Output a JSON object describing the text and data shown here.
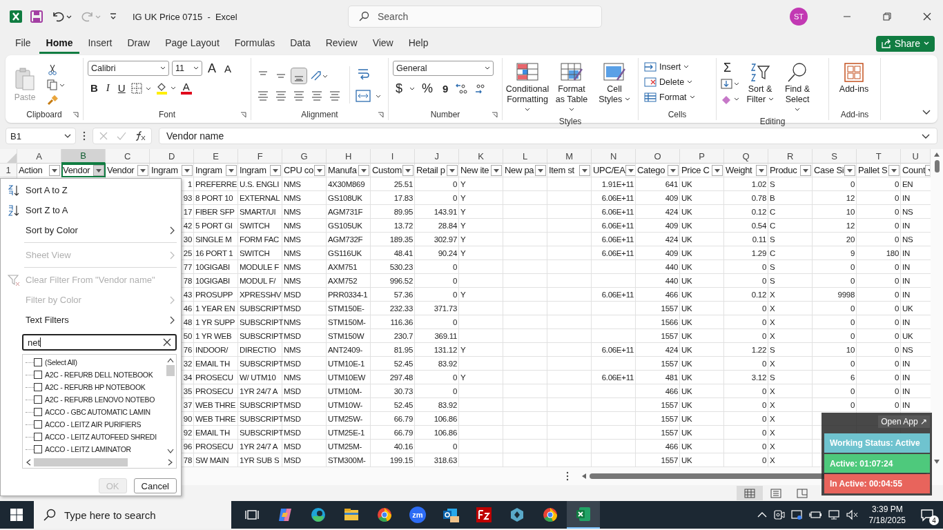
{
  "titlebar": {
    "title": "IG UK Price 0715  -  Excel",
    "search_placeholder": "Search",
    "avatar": "ST"
  },
  "menu_tabs": [
    {
      "label": "File",
      "selected": false
    },
    {
      "label": "Home",
      "selected": true
    },
    {
      "label": "Insert",
      "selected": false
    },
    {
      "label": "Draw",
      "selected": false
    },
    {
      "label": "Page Layout",
      "selected": false
    },
    {
      "label": "Formulas",
      "selected": false
    },
    {
      "label": "Data",
      "selected": false
    },
    {
      "label": "Review",
      "selected": false
    },
    {
      "label": "View",
      "selected": false
    },
    {
      "label": "Help",
      "selected": false
    }
  ],
  "share": "Share",
  "ribbon": {
    "clipboard": {
      "paste": "Paste",
      "label": "Clipboard"
    },
    "font": {
      "name": "Calibri",
      "size": "11",
      "grow": "A",
      "shrink": "A",
      "bold": "B",
      "italic": "I",
      "underline": "U",
      "color_glyph": "A",
      "label": "Font"
    },
    "alignment": {
      "label": "Alignment",
      "vertical": [
        {
          "kind": "top",
          "on": false
        },
        {
          "kind": "middle",
          "on": false
        },
        {
          "kind": "bottom",
          "on": true
        }
      ]
    },
    "number": {
      "format": "General",
      "currency": "$",
      "percent": "%",
      "comma": "9",
      "label": "Number"
    },
    "styles": {
      "buttons": [
        {
          "label": "Conditional Formatting",
          "kind": "conditional"
        },
        {
          "label": "Format as Table",
          "kind": "table"
        },
        {
          "label": "Cell Styles",
          "kind": "cell-styles"
        }
      ],
      "label": "Styles"
    },
    "cells": {
      "buttons": [
        {
          "label": "Insert",
          "kind": "insert"
        },
        {
          "label": "Delete",
          "kind": "delete"
        },
        {
          "label": "Format",
          "kind": "format"
        }
      ],
      "label": "Cells"
    },
    "editing": {
      "sum": "Σ",
      "buttons": [
        {
          "label": "Sort & Filter",
          "kind": "sort"
        },
        {
          "label": "Find & Select",
          "kind": "find"
        }
      ],
      "label": "Editing"
    },
    "addins": {
      "button": "Add-ins",
      "label": "Add-ins"
    }
  },
  "formula_bar": {
    "name_box": "B1",
    "formula": "Vendor name"
  },
  "row_number": "1",
  "columns": [
    {
      "letter": "A",
      "heading": "Action",
      "selected": false
    },
    {
      "letter": "B",
      "heading": "Vendor",
      "selected": true
    },
    {
      "letter": "C",
      "heading": "Vendor",
      "selected": false
    },
    {
      "letter": "D",
      "heading": "Ingram",
      "kind": "number",
      "selected": false
    },
    {
      "letter": "E",
      "heading": "Ingram",
      "kind": "text",
      "selected": false
    },
    {
      "letter": "F",
      "heading": "Ingram",
      "kind": "text",
      "selected": false
    },
    {
      "letter": "G",
      "heading": "CPU co",
      "kind": "text",
      "selected": false
    },
    {
      "letter": "H",
      "heading": "Manufa",
      "kind": "text",
      "selected": false
    },
    {
      "letter": "I",
      "heading": "Custom",
      "kind": "number",
      "selected": false
    },
    {
      "letter": "J",
      "heading": "Retail p",
      "kind": "number",
      "selected": false
    },
    {
      "letter": "K",
      "heading": "New ite",
      "kind": "text",
      "selected": false
    },
    {
      "letter": "L",
      "heading": "New pa",
      "selected": false
    },
    {
      "letter": "M",
      "heading": "Item st",
      "selected": false
    },
    {
      "letter": "N",
      "heading": "UPC/EA",
      "kind": "number",
      "selected": false
    },
    {
      "letter": "O",
      "heading": "Catego",
      "kind": "number",
      "selected": false
    },
    {
      "letter": "P",
      "heading": "Price C",
      "kind": "text",
      "selected": false
    },
    {
      "letter": "Q",
      "heading": "Weight",
      "kind": "number",
      "selected": false
    },
    {
      "letter": "R",
      "heading": "Produc",
      "kind": "text",
      "selected": false
    },
    {
      "letter": "S",
      "heading": "Case Si",
      "kind": "number",
      "selected": false
    },
    {
      "letter": "T",
      "heading": "Pallet S",
      "kind": "number",
      "selected": false
    },
    {
      "letter": "U",
      "heading": "Count",
      "kind": "text",
      "selected": false
    }
  ],
  "rows": [
    {
      "D": "1",
      "E": "PREFERRE",
      "F": "U.S. ENGLI",
      "G": "NMS",
      "H": "4X30M869",
      "I": "25.51",
      "J": "0",
      "K": "Y",
      "N": "1.91E+11",
      "O": "641",
      "P": "UK",
      "Q": "1.02",
      "R": "S",
      "S": "0",
      "T": "0",
      "U": "EN"
    },
    {
      "D": "93",
      "E": "8 PORT 10",
      "F": "EXTERNAL",
      "G": "NMS",
      "H": "GS108UK",
      "I": "17.83",
      "J": "0",
      "K": "Y",
      "N": "6.06E+11",
      "O": "409",
      "P": "UK",
      "Q": "0.78",
      "R": "B",
      "S": "12",
      "T": "0",
      "U": "IN"
    },
    {
      "D": "17",
      "E": "FIBER SFP",
      "F": "SMART/UI",
      "G": "NMS",
      "H": "AGM731F",
      "I": "89.95",
      "J": "143.91",
      "K": "Y",
      "N": "6.06E+11",
      "O": "424",
      "P": "UK",
      "Q": "0.12",
      "R": "C",
      "S": "10",
      "T": "0",
      "U": "NS"
    },
    {
      "D": "42",
      "E": "5 PORT GI",
      "F": "SWITCH",
      "G": "NMS",
      "H": "GS105UK",
      "I": "13.72",
      "J": "28.84",
      "K": "Y",
      "N": "6.06E+11",
      "O": "409",
      "P": "UK",
      "Q": "0.54",
      "R": "C",
      "S": "12",
      "T": "0",
      "U": "IN"
    },
    {
      "D": "30",
      "E": "SINGLE M",
      "F": "FORM FAC",
      "G": "NMS",
      "H": "AGM732F",
      "I": "189.35",
      "J": "302.97",
      "K": "Y",
      "N": "6.06E+11",
      "O": "424",
      "P": "UK",
      "Q": "0.11",
      "R": "S",
      "S": "20",
      "T": "0",
      "U": "NS"
    },
    {
      "D": "25",
      "E": "16 PORT 1",
      "F": "SWITCH",
      "G": "NMS",
      "H": "GS116UK",
      "I": "48.41",
      "J": "90.24",
      "K": "Y",
      "N": "6.06E+11",
      "O": "409",
      "P": "UK",
      "Q": "1.29",
      "R": "C",
      "S": "9",
      "T": "180",
      "U": "IN"
    },
    {
      "D": "77",
      "E": "10GIGABI",
      "F": "MODULE F",
      "G": "NMS",
      "H": "AXM751",
      "I": "530.23",
      "J": "0",
      "O": "440",
      "P": "UK",
      "Q": "0",
      "R": "S",
      "S": "0",
      "T": "0",
      "U": "IN"
    },
    {
      "D": "78",
      "E": "10GIGABI",
      "F": "MODUL F/",
      "G": "NMS",
      "H": "AXM752",
      "I": "996.52",
      "J": "0",
      "O": "440",
      "P": "UK",
      "Q": "0",
      "R": "S",
      "S": "0",
      "T": "0",
      "U": "IN"
    },
    {
      "D": "43",
      "E": "PROSUPP",
      "F": "XPRESSHV",
      "G": "MSD",
      "H": "PRR0334-1",
      "I": "57.36",
      "J": "0",
      "K": "Y",
      "N": "6.06E+11",
      "O": "466",
      "P": "UK",
      "Q": "0.12",
      "R": "X",
      "S": "9998",
      "T": "0",
      "U": "IN"
    },
    {
      "D": "46",
      "E": "1 YEAR EN",
      "F": "SUBSCRIPT",
      "G": "MSD",
      "H": "STM150E-",
      "I": "232.33",
      "J": "371.73",
      "O": "1557",
      "P": "UK",
      "Q": "0",
      "R": "X",
      "S": "0",
      "T": "0",
      "U": "UK"
    },
    {
      "D": "48",
      "E": "1 YR SUPP",
      "F": "SUBSCRIPT",
      "G": "NMS",
      "H": "STM150M-",
      "I": "116.36",
      "J": "0",
      "O": "1566",
      "P": "UK",
      "Q": "0",
      "R": "X",
      "S": "0",
      "T": "0",
      "U": "IN"
    },
    {
      "D": "50",
      "E": "1 YR WEB",
      "F": "SUBSCRIPT",
      "G": "MSD",
      "H": "STM150W",
      "I": "230.7",
      "J": "369.11",
      "O": "1557",
      "P": "UK",
      "Q": "0",
      "R": "X",
      "S": "0",
      "T": "0",
      "U": "UK"
    },
    {
      "D": "76",
      "E": "INDOOR/",
      "F": "DIRECTIO",
      "G": "NMS",
      "H": "ANT2409-",
      "I": "81.95",
      "J": "131.12",
      "K": "Y",
      "N": "6.06E+11",
      "O": "424",
      "P": "UK",
      "Q": "1.22",
      "R": "S",
      "S": "10",
      "T": "0",
      "U": "NS"
    },
    {
      "D": "32",
      "E": "EMAIL TH",
      "F": "SUBSCRIPT",
      "G": "MSD",
      "H": "UTM10E-1",
      "I": "52.45",
      "J": "83.92",
      "O": "1557",
      "P": "UK",
      "Q": "0",
      "R": "X",
      "S": "0",
      "T": "0",
      "U": "IN"
    },
    {
      "D": "34",
      "E": "PROSECU",
      "F": "W/ UTM10",
      "G": "NMS",
      "H": "UTM10EW",
      "I": "297.48",
      "J": "0",
      "K": "Y",
      "N": "6.06E+11",
      "O": "481",
      "P": "UK",
      "Q": "3.12",
      "R": "S",
      "S": "6",
      "T": "0",
      "U": "IN"
    },
    {
      "D": "35",
      "E": "PROSECU",
      "F": "1YR 24/7 A",
      "G": "MSD",
      "H": "UTM10M-",
      "I": "30.73",
      "J": "0",
      "O": "466",
      "P": "UK",
      "Q": "0",
      "R": "X",
      "S": "0",
      "T": "0",
      "U": "IN"
    },
    {
      "D": "37",
      "E": "WEB THRE",
      "F": "SUBSCRIPT",
      "G": "MSD",
      "H": "UTM10W-",
      "I": "52.45",
      "J": "83.92",
      "O": "1557",
      "P": "UK",
      "Q": "0",
      "R": "X",
      "S": "0",
      "T": "0",
      "U": "IN"
    },
    {
      "D": "90",
      "E": "WEB THRE",
      "F": "SUBSCRIPT",
      "G": "MSD",
      "H": "UTM25W-",
      "I": "66.79",
      "J": "106.86",
      "O": "1557",
      "P": "UK",
      "Q": "0",
      "R": "X"
    },
    {
      "D": "92",
      "E": "EMAIL TH",
      "F": "SUBSCRIPT",
      "G": "MSD",
      "H": "UTM25E-1",
      "I": "66.79",
      "J": "106.86",
      "O": "1557",
      "P": "UK",
      "Q": "0",
      "R": "X"
    },
    {
      "D": "96",
      "E": "PROSECU",
      "F": "1YR 24/7 A",
      "G": "MSD",
      "H": "UTM25M-",
      "I": "40.16",
      "J": "0",
      "O": "466",
      "P": "UK",
      "Q": "0",
      "R": "X"
    },
    {
      "D": "78",
      "E": "SW MAIN",
      "F": "1YR SUB S",
      "G": "MSD",
      "H": "STM300M-",
      "I": "199.15",
      "J": "318.63",
      "O": "1557",
      "P": "UK",
      "Q": "0",
      "R": "X"
    }
  ],
  "filter_menu": {
    "items": [
      {
        "label": "Sort A to Z",
        "kind": "sort-asc",
        "disabled": false,
        "submenu": false
      },
      {
        "label": "Sort Z to A",
        "kind": "sort-desc",
        "disabled": false,
        "submenu": false
      },
      {
        "label": "Sort by Color",
        "kind": "plain",
        "disabled": false,
        "submenu": true
      },
      {
        "kind": "separator"
      },
      {
        "label": "Sheet View",
        "kind": "plain",
        "disabled": true,
        "submenu": true
      },
      {
        "kind": "separator"
      },
      {
        "label": "Clear Filter From \"Vendor name\"",
        "kind": "clear",
        "disabled": true,
        "submenu": false
      },
      {
        "label": "Filter by Color",
        "kind": "plain",
        "disabled": true,
        "submenu": true
      },
      {
        "label": "Text Filters",
        "kind": "plain",
        "disabled": false,
        "submenu": true
      }
    ],
    "search": "net",
    "values": [
      {
        "label": "(Select All)",
        "checked": false
      },
      {
        "label": "A2C - REFURB DELL NOTEBOOK",
        "checked": false
      },
      {
        "label": "A2C - REFURB HP NOTEBOOK",
        "checked": false
      },
      {
        "label": "A2C - REFURB LENOVO NOTEBO",
        "checked": false
      },
      {
        "label": "ACCO - GBC AUTOMATIC LAMIN",
        "checked": false
      },
      {
        "label": "ACCO - LEITZ AIR PURIFIERS",
        "checked": false
      },
      {
        "label": "ACCO - LEITZ AUTOFEED SHREDI",
        "checked": false
      },
      {
        "label": "ACCO - LEITZ LAMINATOR",
        "checked": false
      }
    ],
    "ok": "OK",
    "ok_disabled": true,
    "cancel": "Cancel"
  },
  "view_buttons": [
    {
      "kind": "normal",
      "selected": true
    },
    {
      "kind": "page-layout",
      "selected": false
    },
    {
      "kind": "page-break",
      "selected": false
    }
  ],
  "tracker": {
    "open": "Open App ↗",
    "statuses": [
      {
        "label": "Working Status: Active",
        "color": "#6fc3cf"
      },
      {
        "label": "Active: 01:07:24",
        "color": "#4ec97c"
      },
      {
        "label": "In Active: 00:04:55",
        "color": "#e8645c"
      }
    ]
  },
  "taskbar": {
    "search_placeholder": "Type here to search",
    "apps": [
      {
        "kind": "task-view",
        "selected": false
      },
      {
        "kind": "copilot",
        "selected": false
      },
      {
        "kind": "edge",
        "selected": false
      },
      {
        "kind": "explorer",
        "selected": false
      },
      {
        "kind": "chrome",
        "selected": false
      },
      {
        "kind": "zoom",
        "glyph": "zm",
        "selected": false
      },
      {
        "kind": "outlook",
        "selected": false
      },
      {
        "kind": "filezilla",
        "selected": false
      },
      {
        "kind": "cube",
        "selected": false
      },
      {
        "kind": "chrome",
        "selected": false
      },
      {
        "kind": "excel",
        "selected": true
      }
    ],
    "time": "3:39 PM",
    "date": "7/18/2025",
    "notifications": "4"
  }
}
